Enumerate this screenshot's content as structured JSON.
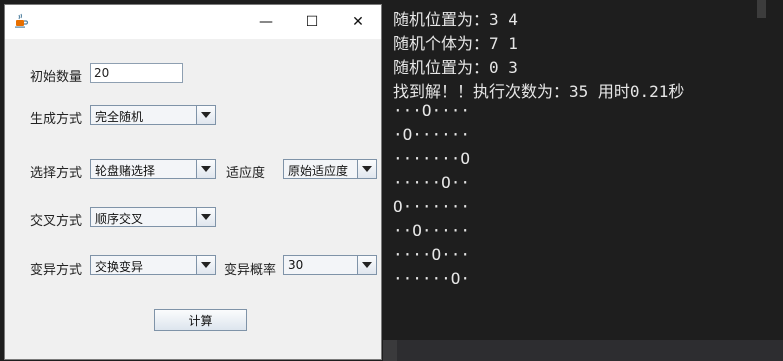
{
  "ide": {
    "code_fragment": "}   "
  },
  "console": {
    "lines": [
      "随机位置为：3 4",
      "随机个体为：7 1",
      "随机位置为：0 3",
      "找到解！！执行次数为：35 用时0.21秒"
    ],
    "board": [
      "···O····",
      "·O······",
      "·······O",
      "·····O··",
      "O·······",
      "··O·····",
      "····O···",
      "······O·"
    ]
  },
  "dialog": {
    "window_buttons": {
      "minimize": "—",
      "maximize": "☐",
      "close": "✕"
    },
    "initial_count": {
      "label": "初始数量",
      "value": "20"
    },
    "generation": {
      "label": "生成方式",
      "selected": "完全随机"
    },
    "selection": {
      "label": "选择方式",
      "selected": "轮盘赌选择"
    },
    "fitness": {
      "label": "适应度",
      "selected": "原始适应度"
    },
    "crossover": {
      "label": "交叉方式",
      "selected": "顺序交叉"
    },
    "mutation": {
      "label": "变异方式",
      "selected": "交换变异"
    },
    "mutation_rate": {
      "label": "变异概率",
      "selected": "30"
    },
    "compute_button": "计算"
  },
  "colors": {
    "console_bg": "#1e1e1e",
    "dialog_bg": "#f0f0f0"
  },
  "icons": {
    "app": "java-cup-icon"
  }
}
